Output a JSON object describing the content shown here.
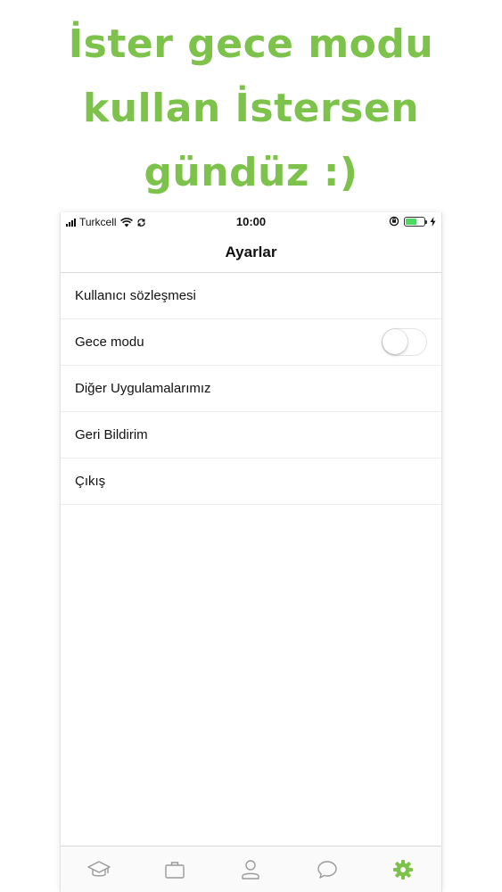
{
  "promo": {
    "lines": [
      "İster gece modu",
      "kullan İstersen",
      "gündüz :)"
    ],
    "color": "#7dc24b"
  },
  "status_bar": {
    "carrier": "Turkcell",
    "time": "10:00",
    "icons": [
      "signal-icon",
      "wifi-icon",
      "sync-icon",
      "orientation-lock-icon",
      "battery-icon",
      "charging-icon"
    ]
  },
  "nav": {
    "title": "Ayarlar"
  },
  "settings": {
    "items": [
      {
        "label": "Kullanıcı sözleşmesi"
      },
      {
        "label": "Gece modu",
        "toggle": false
      },
      {
        "label": "Diğer Uygulamalarımız"
      },
      {
        "label": "Geri Bildirim"
      },
      {
        "label": "Çıkış"
      }
    ]
  },
  "tab_bar": {
    "items": [
      {
        "icon": "graduation-cap-icon",
        "active": false
      },
      {
        "icon": "briefcase-icon",
        "active": false
      },
      {
        "icon": "user-icon",
        "active": false
      },
      {
        "icon": "chat-bubble-icon",
        "active": false
      },
      {
        "icon": "gear-icon",
        "active": true
      }
    ],
    "active_color": "#7dc24b",
    "inactive_color": "#9a9a9a"
  }
}
